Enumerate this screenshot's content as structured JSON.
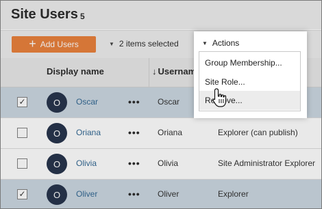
{
  "page": {
    "title": "Site Users",
    "count": "5"
  },
  "toolbar": {
    "add_users_label": "Add Users",
    "items_selected": "2 items selected",
    "actions_label": "Actions"
  },
  "table": {
    "columns": [
      "Display name",
      "Username"
    ],
    "rows": [
      {
        "checked": true,
        "check_mark": "✓",
        "initial": "O",
        "display_name": "Oscar",
        "more": "•••",
        "username": "Oscar",
        "role": ""
      },
      {
        "checked": false,
        "check_mark": "",
        "initial": "O",
        "display_name": "Oriana",
        "more": "•••",
        "username": "Oriana",
        "role": "Explorer (can publish)"
      },
      {
        "checked": false,
        "check_mark": "",
        "initial": "O",
        "display_name": "Olivia",
        "more": "•••",
        "username": "Olivia",
        "role": "Site Administrator Explorer"
      },
      {
        "checked": true,
        "check_mark": "✓",
        "initial": "O",
        "display_name": "Oliver",
        "more": "•••",
        "username": "Oliver",
        "role": "Explorer"
      }
    ]
  },
  "actions_menu": {
    "items": [
      "Group Membership...",
      "Site Role...",
      "Remove..."
    ],
    "hovered_item": "Remove..."
  },
  "icons": {
    "add": "plus-icon",
    "dropdown": "caret-down-icon",
    "sort": "sort-down-arrow-icon",
    "pointer": "hand-cursor-icon"
  },
  "colors": {
    "accent": "#e8762c",
    "avatar": "#15233d",
    "link": "#1f5a8a",
    "selected_row": "#c8d5df"
  }
}
